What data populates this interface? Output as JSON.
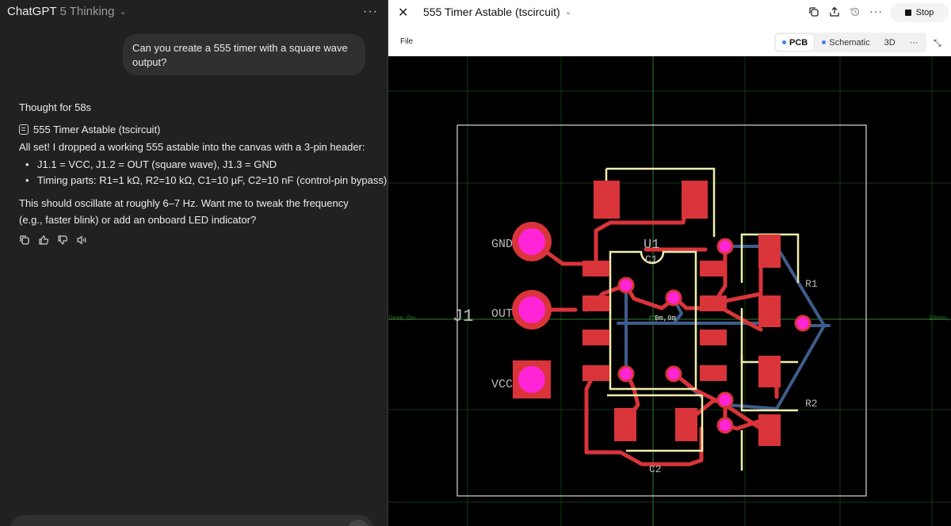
{
  "chat": {
    "model_name": "ChatGPT",
    "model_variant": "5 Thinking",
    "user_message": "Can you create a 555 timer with a square wave output?",
    "thought_label": "Thought for 58s",
    "canvas_link": "555 Timer Astable (tscircuit)",
    "intro": "All set! I dropped a working 555 astable into the canvas with a 3-pin header:",
    "bullets": [
      "J1.1 = VCC, J1.2 = OUT (square wave), J1.3 = GND",
      "Timing parts: R1=1 kΩ, R2=10 kΩ, C1=10 µF, C2=10 nF (control-pin bypass)"
    ],
    "closing": "This should oscillate at roughly 6–7 Hz. Want me to tweak the frequency (e.g., faster blink) or add an onboard LED indicator?"
  },
  "canvas": {
    "title": "555 Timer Astable (tscircuit)",
    "stop_label": "Stop",
    "file_menu": "File",
    "tabs": [
      {
        "label": "PCB",
        "active": true,
        "dot": true
      },
      {
        "label": "Schematic",
        "active": false,
        "dot": true
      },
      {
        "label": "3D",
        "active": false,
        "dot": false
      },
      {
        "label": "···",
        "active": false,
        "dot": false
      }
    ]
  },
  "pcb": {
    "labels": {
      "j1": "J1",
      "gnd": "GND",
      "out": "OUT",
      "vcc": "VCC",
      "u1": "U1",
      "c1": "C1",
      "r1": "R1",
      "r2": "R2",
      "c2": "C2",
      "origin": "0m,0m",
      "left_axis": "0mm, 0m",
      "right_axis": "10mm,"
    },
    "colors": {
      "background": "#000000",
      "pad": "#d9343a",
      "via": "#ff24d6",
      "top_trace": "#d9343a",
      "bottom_trace": "#3f5d8c",
      "silkscreen": "#f2eeae",
      "board_outline": "#ffffff",
      "grid": "#0f3a0f"
    }
  }
}
